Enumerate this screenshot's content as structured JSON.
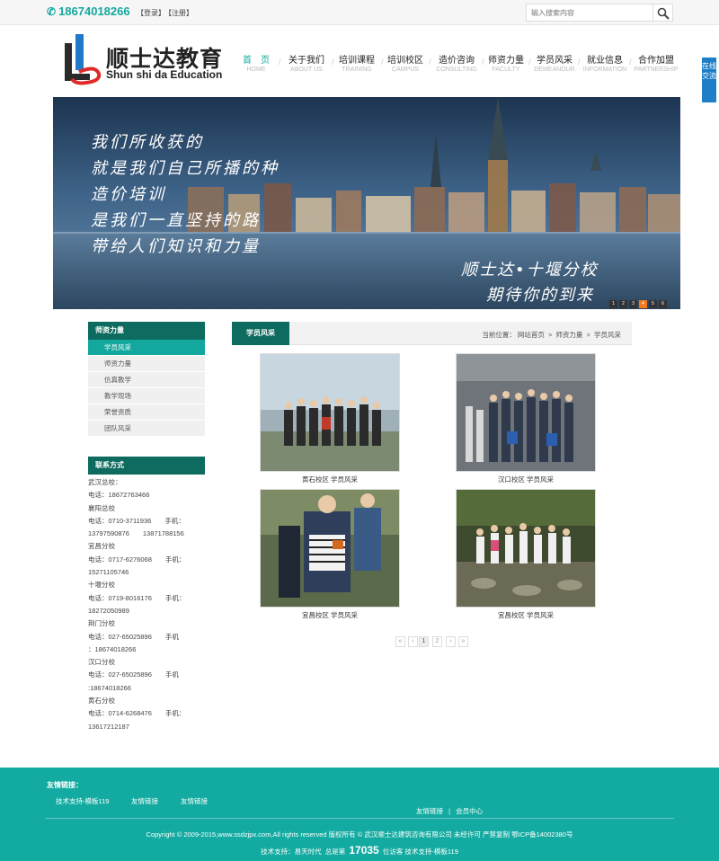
{
  "topbar": {
    "phone": "18674018266",
    "login": "【登录】",
    "register": "【注册】",
    "search_placeholder": "输入搜索内容"
  },
  "logo": {
    "cn": "顺士达教育",
    "en": "Shun shi da Education"
  },
  "nav": [
    {
      "cn": "首　页",
      "en": "HOME"
    },
    {
      "cn": "关于我们",
      "en": "ABOUT US"
    },
    {
      "cn": "培训课程",
      "en": "TRAINING"
    },
    {
      "cn": "培训校区",
      "en": "CAMPUS"
    },
    {
      "cn": "造价咨询",
      "en": "CONSULTING"
    },
    {
      "cn": "师资力量",
      "en": "FACULTY"
    },
    {
      "cn": "学员风采",
      "en": "DEMEANOUR"
    },
    {
      "cn": "就业信息",
      "en": "INFORMATION"
    },
    {
      "cn": "合作加盟",
      "en": "PARTNERSHIP"
    }
  ],
  "side_tab": "在线交流",
  "banner": {
    "poem": [
      "我们所收获的",
      "就是我们自己所播的种",
      "造价培训",
      "是我们一直坚持的路",
      "带给人们知识和力量"
    ],
    "slogan_line1": "顺士达•十堰分校",
    "slogan_line2": "期待你的到来",
    "dots": [
      "1",
      "2",
      "3",
      "4",
      "5",
      "6"
    ]
  },
  "sidebar": {
    "title": "师资力量",
    "items": [
      "学员风采",
      "师资力量",
      "仿真教学",
      "教学现场",
      "荣誉资质",
      "团队风采"
    ],
    "contact_title": "联系方式",
    "contacts": [
      "武汉总校：",
      "电话：18672763466",
      "襄阳总校",
      "电话：0710-3711936　　手机：",
      "13797590876　　13871788156",
      "宜昌分校",
      "电话：0717-6276068　　手机：",
      "15271105746",
      "十堰分校",
      " 电话：0719-8016176　　手机：",
      "18272050989",
      "荆门分校",
      "电话：027-65025896　　手机",
      "：18674018266",
      "汉口分校",
      "电话：027-65025896　　手机",
      ":18674018266",
      "黄石分校",
      "电话：0714-6268476　　手机：",
      "13617212187"
    ]
  },
  "main": {
    "tab": "学员风采",
    "breadcrumb": {
      "label": "当前位置：",
      "home": "网站首页",
      "sep": ">",
      "level1": "师资力量",
      "level2": "学员风采"
    },
    "gallery": [
      {
        "caption": "黄石校区 学员风采"
      },
      {
        "caption": "汉口校区 学员风采"
      },
      {
        "caption": "宜昌校区 学员风采"
      },
      {
        "caption": "宜昌校区 学员风采"
      }
    ],
    "pager": [
      "«",
      "‹",
      "1",
      "2",
      "›",
      "»"
    ]
  },
  "footer": {
    "links_title": "友情链接：",
    "links": [
      "技术支持-模板119",
      "友情链接",
      "友情链接"
    ],
    "mid_link1": "友情链接",
    "mid_sep": "|",
    "mid_link2": "会员中心",
    "copyright": "Copyright © 2009-2015,www.ssdzjpx.com,All rights reserved 版权所有 ©  武汉顺士达建筑咨询有限公司 未经许可 严禁复制 鄂ICP备14002380号",
    "tech_label": "技术支持：易天时代",
    "visits_label": "总是第",
    "visits": "17035",
    "visits_suffix": "位访客",
    "tech_suffix": "技术支持-模板119"
  },
  "colors": {
    "teal": "#13a89e",
    "dark_teal": "#0e6b5f",
    "footer": "#13aba1",
    "side_tab": "#1e7ec8",
    "active_dot": "#f07a1e"
  }
}
